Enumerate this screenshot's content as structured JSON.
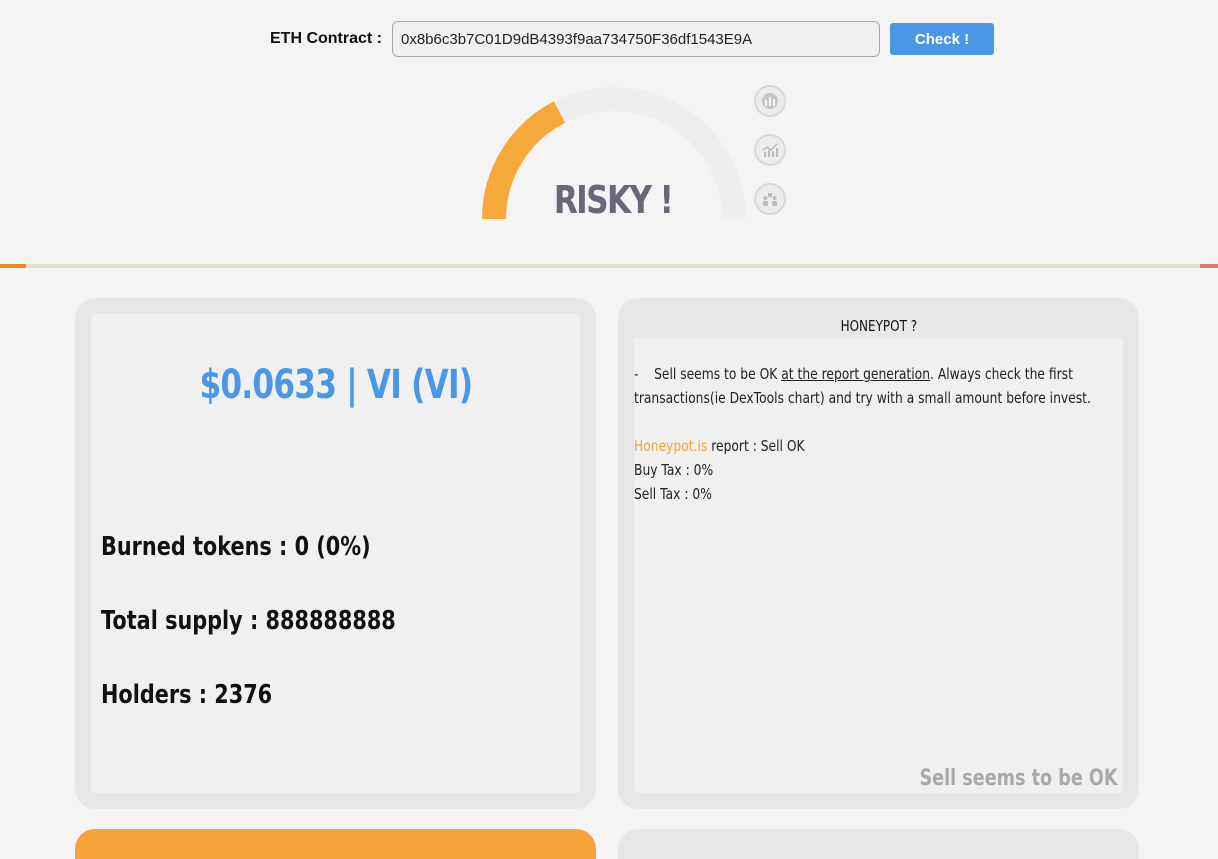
{
  "search": {
    "label": "ETH Contract :",
    "value": "0x8b6c3b7C01D9dB4393f9aa734750F36df1543E9A",
    "button_label": "Check !"
  },
  "gauge": {
    "label": "RISKY !",
    "level": 0.35,
    "fill_color": "#f5a93a",
    "track_color": "#eeeeee",
    "side_buttons": [
      "chart-icon",
      "bar-chart-icon",
      "users-icon"
    ]
  },
  "progress": {
    "fill_color": "#f08b15",
    "end_color": "#e9707a"
  },
  "token": {
    "price_title": "$0.0633 | VI (VI)",
    "burned": "Burned tokens : 0 (0%)",
    "supply": "Total supply : 888888888",
    "holders": "Holders : 2376"
  },
  "honeypot": {
    "title": "HONEYPOT ?",
    "line1_dash": "-",
    "line1_a": "Sell seems to be OK ",
    "line1_link": "at the report generation",
    "line1_b": ". Always check the first",
    "line2": "transactions(ie DexTools chart) and try with a small amount before invest.",
    "provider_link": "Honeypot.is",
    "provider_text": " report : Sell OK",
    "buy_tax": "Buy Tax : 0%",
    "sell_tax": "Sell Tax : 0%",
    "footer": "Sell seems to be OK"
  }
}
